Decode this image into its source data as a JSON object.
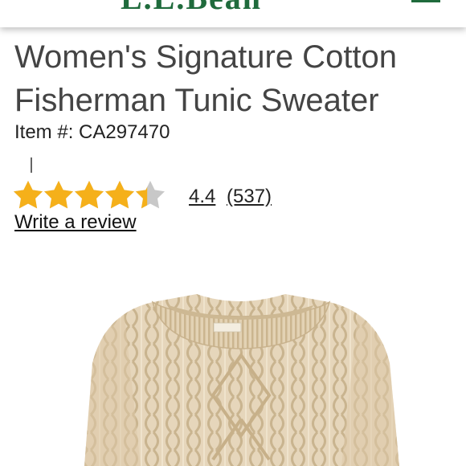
{
  "header": {
    "brand": "L.L.Bean",
    "menu_icon": "hamburger-menu-icon"
  },
  "product": {
    "title": "Women's Signature Cotton Fisherman Tunic Sweater",
    "item_number": "Item #: CA297470",
    "rating_value": 4.4,
    "rating_max": 5,
    "rating_text": "4.4",
    "review_count": "(537)",
    "write_review": "Write a review",
    "image": "cream-cable-knit-fisherman-sweater"
  },
  "colors": {
    "star_filled": "#f5b01a",
    "star_empty": "#c8c8c8",
    "brand_green": "#1f6b3c",
    "sweater": "#e7d8bd"
  }
}
